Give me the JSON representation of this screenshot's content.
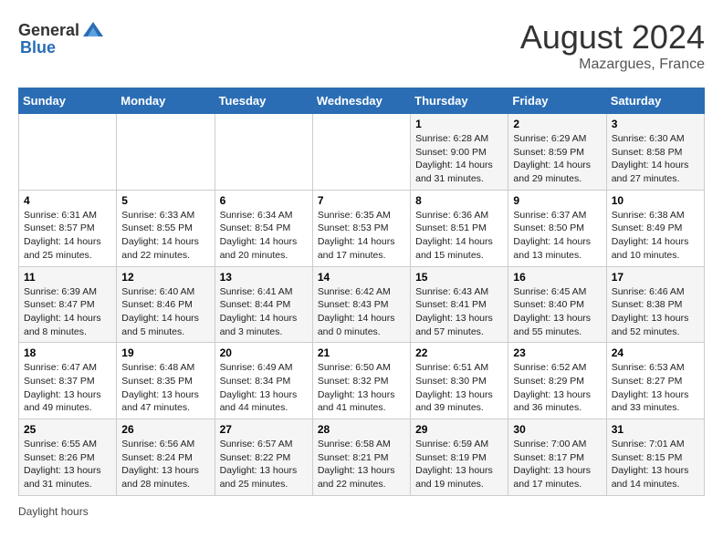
{
  "header": {
    "logo_general": "General",
    "logo_blue": "Blue",
    "month_year": "August 2024",
    "location": "Mazargues, France"
  },
  "footer": {
    "daylight_label": "Daylight hours"
  },
  "weekdays": [
    "Sunday",
    "Monday",
    "Tuesday",
    "Wednesday",
    "Thursday",
    "Friday",
    "Saturday"
  ],
  "weeks": [
    [
      {
        "day": "",
        "info": ""
      },
      {
        "day": "",
        "info": ""
      },
      {
        "day": "",
        "info": ""
      },
      {
        "day": "",
        "info": ""
      },
      {
        "day": "1",
        "info": "Sunrise: 6:28 AM\nSunset: 9:00 PM\nDaylight: 14 hours and 31 minutes."
      },
      {
        "day": "2",
        "info": "Sunrise: 6:29 AM\nSunset: 8:59 PM\nDaylight: 14 hours and 29 minutes."
      },
      {
        "day": "3",
        "info": "Sunrise: 6:30 AM\nSunset: 8:58 PM\nDaylight: 14 hours and 27 minutes."
      }
    ],
    [
      {
        "day": "4",
        "info": "Sunrise: 6:31 AM\nSunset: 8:57 PM\nDaylight: 14 hours and 25 minutes."
      },
      {
        "day": "5",
        "info": "Sunrise: 6:33 AM\nSunset: 8:55 PM\nDaylight: 14 hours and 22 minutes."
      },
      {
        "day": "6",
        "info": "Sunrise: 6:34 AM\nSunset: 8:54 PM\nDaylight: 14 hours and 20 minutes."
      },
      {
        "day": "7",
        "info": "Sunrise: 6:35 AM\nSunset: 8:53 PM\nDaylight: 14 hours and 17 minutes."
      },
      {
        "day": "8",
        "info": "Sunrise: 6:36 AM\nSunset: 8:51 PM\nDaylight: 14 hours and 15 minutes."
      },
      {
        "day": "9",
        "info": "Sunrise: 6:37 AM\nSunset: 8:50 PM\nDaylight: 14 hours and 13 minutes."
      },
      {
        "day": "10",
        "info": "Sunrise: 6:38 AM\nSunset: 8:49 PM\nDaylight: 14 hours and 10 minutes."
      }
    ],
    [
      {
        "day": "11",
        "info": "Sunrise: 6:39 AM\nSunset: 8:47 PM\nDaylight: 14 hours and 8 minutes."
      },
      {
        "day": "12",
        "info": "Sunrise: 6:40 AM\nSunset: 8:46 PM\nDaylight: 14 hours and 5 minutes."
      },
      {
        "day": "13",
        "info": "Sunrise: 6:41 AM\nSunset: 8:44 PM\nDaylight: 14 hours and 3 minutes."
      },
      {
        "day": "14",
        "info": "Sunrise: 6:42 AM\nSunset: 8:43 PM\nDaylight: 14 hours and 0 minutes."
      },
      {
        "day": "15",
        "info": "Sunrise: 6:43 AM\nSunset: 8:41 PM\nDaylight: 13 hours and 57 minutes."
      },
      {
        "day": "16",
        "info": "Sunrise: 6:45 AM\nSunset: 8:40 PM\nDaylight: 13 hours and 55 minutes."
      },
      {
        "day": "17",
        "info": "Sunrise: 6:46 AM\nSunset: 8:38 PM\nDaylight: 13 hours and 52 minutes."
      }
    ],
    [
      {
        "day": "18",
        "info": "Sunrise: 6:47 AM\nSunset: 8:37 PM\nDaylight: 13 hours and 49 minutes."
      },
      {
        "day": "19",
        "info": "Sunrise: 6:48 AM\nSunset: 8:35 PM\nDaylight: 13 hours and 47 minutes."
      },
      {
        "day": "20",
        "info": "Sunrise: 6:49 AM\nSunset: 8:34 PM\nDaylight: 13 hours and 44 minutes."
      },
      {
        "day": "21",
        "info": "Sunrise: 6:50 AM\nSunset: 8:32 PM\nDaylight: 13 hours and 41 minutes."
      },
      {
        "day": "22",
        "info": "Sunrise: 6:51 AM\nSunset: 8:30 PM\nDaylight: 13 hours and 39 minutes."
      },
      {
        "day": "23",
        "info": "Sunrise: 6:52 AM\nSunset: 8:29 PM\nDaylight: 13 hours and 36 minutes."
      },
      {
        "day": "24",
        "info": "Sunrise: 6:53 AM\nSunset: 8:27 PM\nDaylight: 13 hours and 33 minutes."
      }
    ],
    [
      {
        "day": "25",
        "info": "Sunrise: 6:55 AM\nSunset: 8:26 PM\nDaylight: 13 hours and 31 minutes."
      },
      {
        "day": "26",
        "info": "Sunrise: 6:56 AM\nSunset: 8:24 PM\nDaylight: 13 hours and 28 minutes."
      },
      {
        "day": "27",
        "info": "Sunrise: 6:57 AM\nSunset: 8:22 PM\nDaylight: 13 hours and 25 minutes."
      },
      {
        "day": "28",
        "info": "Sunrise: 6:58 AM\nSunset: 8:21 PM\nDaylight: 13 hours and 22 minutes."
      },
      {
        "day": "29",
        "info": "Sunrise: 6:59 AM\nSunset: 8:19 PM\nDaylight: 13 hours and 19 minutes."
      },
      {
        "day": "30",
        "info": "Sunrise: 7:00 AM\nSunset: 8:17 PM\nDaylight: 13 hours and 17 minutes."
      },
      {
        "day": "31",
        "info": "Sunrise: 7:01 AM\nSunset: 8:15 PM\nDaylight: 13 hours and 14 minutes."
      }
    ]
  ]
}
